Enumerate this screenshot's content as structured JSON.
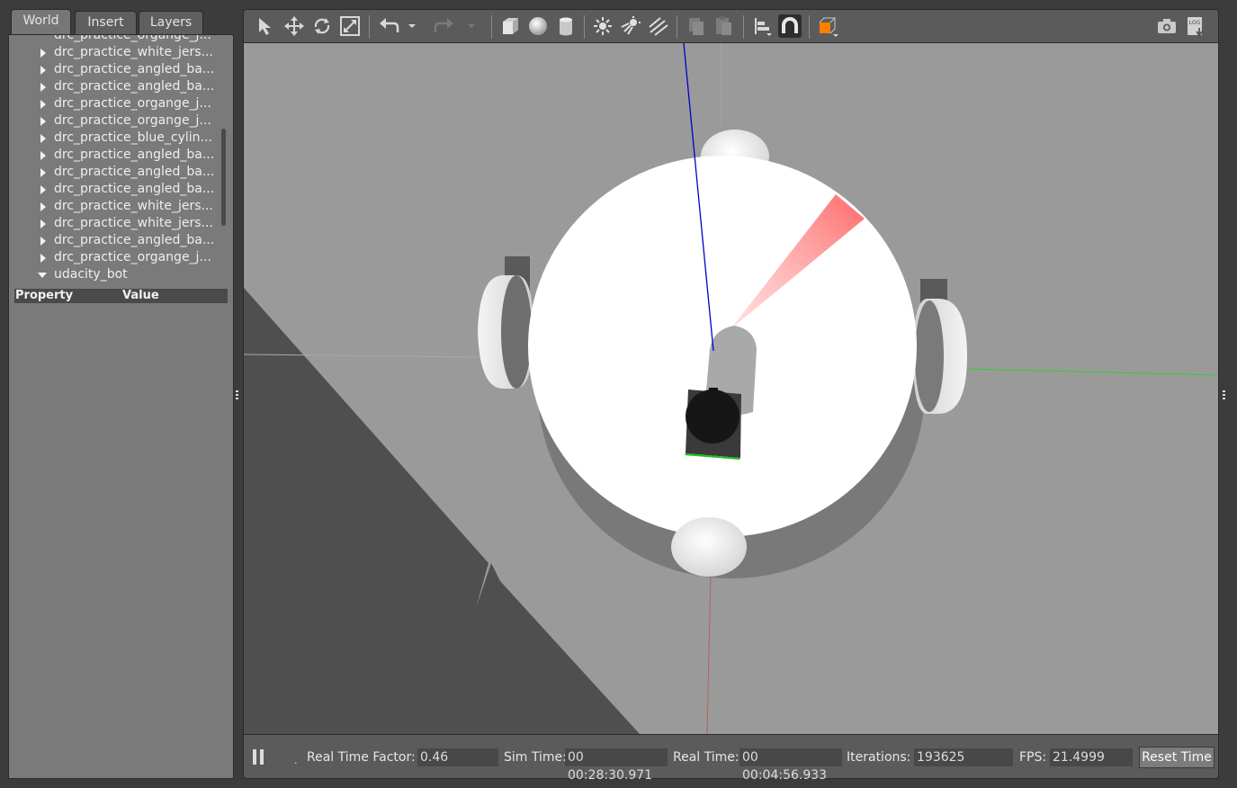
{
  "left_panel": {
    "tabs": [
      {
        "label": "World"
      },
      {
        "label": "Insert"
      },
      {
        "label": "Layers"
      }
    ],
    "tree_items": [
      {
        "label": "drc_practice_organge_j..."
      },
      {
        "label": "drc_practice_white_jers..."
      },
      {
        "label": "drc_practice_angled_ba..."
      },
      {
        "label": "drc_practice_angled_ba..."
      },
      {
        "label": "drc_practice_organge_j..."
      },
      {
        "label": "drc_practice_organge_j..."
      },
      {
        "label": "drc_practice_blue_cylin..."
      },
      {
        "label": "drc_practice_angled_ba..."
      },
      {
        "label": "drc_practice_angled_ba..."
      },
      {
        "label": "drc_practice_angled_ba..."
      },
      {
        "label": "drc_practice_white_jers..."
      },
      {
        "label": "drc_practice_white_jers..."
      },
      {
        "label": "drc_practice_angled_ba..."
      },
      {
        "label": "drc_practice_organge_j..."
      },
      {
        "label": "udacity_bot",
        "expanded": true
      }
    ],
    "property_header": {
      "property": "Property",
      "value": "Value"
    }
  },
  "toolbar": {
    "icons": [
      "select-arrow-icon",
      "translate-icon",
      "rotate-icon",
      "scale-icon",
      "undo-icon",
      "undo-dropdown-icon",
      "redo-icon",
      "redo-dropdown-icon",
      "box-icon",
      "sphere-icon",
      "cylinder-icon",
      "point-light-icon",
      "spot-light-icon",
      "directional-light-icon",
      "copy-icon",
      "paste-icon",
      "align-icon",
      "snap-magnet-icon",
      "view-angle-icon",
      "screenshot-icon",
      "log-icon"
    ],
    "log_text": "LOG"
  },
  "status_bar": {
    "real_time_factor_label": "Real Time Factor:",
    "real_time_factor_value": "0.46",
    "sim_time_label": "Sim Time:",
    "sim_time_value": "00 00:28:30.971",
    "real_time_label": "Real Time:",
    "real_time_value": "00 00:04:56.933",
    "iterations_label": "Iterations:",
    "iterations_value": "193625",
    "fps_label": "FPS:",
    "fps_value": "21.4999",
    "reset_label": "Reset Time",
    "step_text": "."
  },
  "colors": {
    "panel_bg": "#7a7a7a",
    "toolbar_bg": "#5b5b5b",
    "ground": "#9a9a9a",
    "shadow": "#4f4f4f",
    "laser": "#ff6060",
    "axis_z": "#0000cc",
    "axis_y": "#33cc33",
    "axis_x": "#cc3333",
    "selection_orange": "#ff7f00"
  }
}
